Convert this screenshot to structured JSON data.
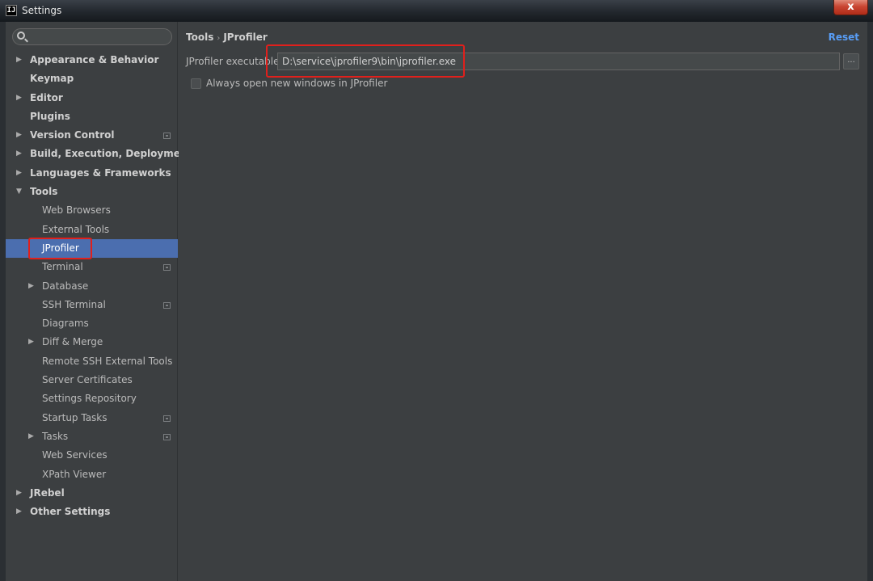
{
  "window": {
    "title": "Settings",
    "app_icon_text": "IJ",
    "close_symbol": "x"
  },
  "search": {
    "icon": "search-icon",
    "value": ""
  },
  "sidebar": {
    "items": [
      {
        "label": "Appearance & Behavior",
        "level": 0,
        "arrow": "▶"
      },
      {
        "label": "Keymap",
        "level": 0,
        "arrow": ""
      },
      {
        "label": "Editor",
        "level": 0,
        "arrow": "▶"
      },
      {
        "label": "Plugins",
        "level": 0,
        "arrow": ""
      },
      {
        "label": "Version Control",
        "level": 0,
        "arrow": "▶",
        "project_icon": true
      },
      {
        "label": "Build, Execution, Deployment",
        "level": 0,
        "arrow": "▶"
      },
      {
        "label": "Languages & Frameworks",
        "level": 0,
        "arrow": "▶"
      },
      {
        "label": "Tools",
        "level": 0,
        "arrow": "▼"
      },
      {
        "label": "Web Browsers",
        "level": 1,
        "arrow": ""
      },
      {
        "label": "External Tools",
        "level": 1,
        "arrow": ""
      },
      {
        "label": "JProfiler",
        "level": 1,
        "arrow": "",
        "selected": true
      },
      {
        "label": "Terminal",
        "level": 1,
        "arrow": "",
        "project_icon": true
      },
      {
        "label": "Database",
        "level": 1,
        "arrow": "▶"
      },
      {
        "label": "SSH Terminal",
        "level": 1,
        "arrow": "",
        "project_icon": true
      },
      {
        "label": "Diagrams",
        "level": 1,
        "arrow": ""
      },
      {
        "label": "Diff & Merge",
        "level": 1,
        "arrow": "▶"
      },
      {
        "label": "Remote SSH External Tools",
        "level": 1,
        "arrow": ""
      },
      {
        "label": "Server Certificates",
        "level": 1,
        "arrow": ""
      },
      {
        "label": "Settings Repository",
        "level": 1,
        "arrow": ""
      },
      {
        "label": "Startup Tasks",
        "level": 1,
        "arrow": "",
        "project_icon": true
      },
      {
        "label": "Tasks",
        "level": 1,
        "arrow": "▶",
        "project_icon": true
      },
      {
        "label": "Web Services",
        "level": 1,
        "arrow": ""
      },
      {
        "label": "XPath Viewer",
        "level": 1,
        "arrow": ""
      },
      {
        "label": "JRebel",
        "level": 0,
        "arrow": "▶"
      },
      {
        "label": "Other Settings",
        "level": 0,
        "arrow": "▶"
      }
    ]
  },
  "content": {
    "breadcrumb_parent": "Tools",
    "breadcrumb_sep": "›",
    "breadcrumb_current": "JProfiler",
    "reset_label": "Reset",
    "executable_label": "JProfiler executable:",
    "executable_value": "D:\\service\\jprofiler9\\bin\\jprofiler.exe",
    "browse_label": "...",
    "always_open_label": "Always open new windows in JProfiler",
    "always_open_checked": false
  },
  "colors": {
    "selection": "#4b6eaf",
    "link": "#589df6",
    "annotation": "#e0201c"
  }
}
